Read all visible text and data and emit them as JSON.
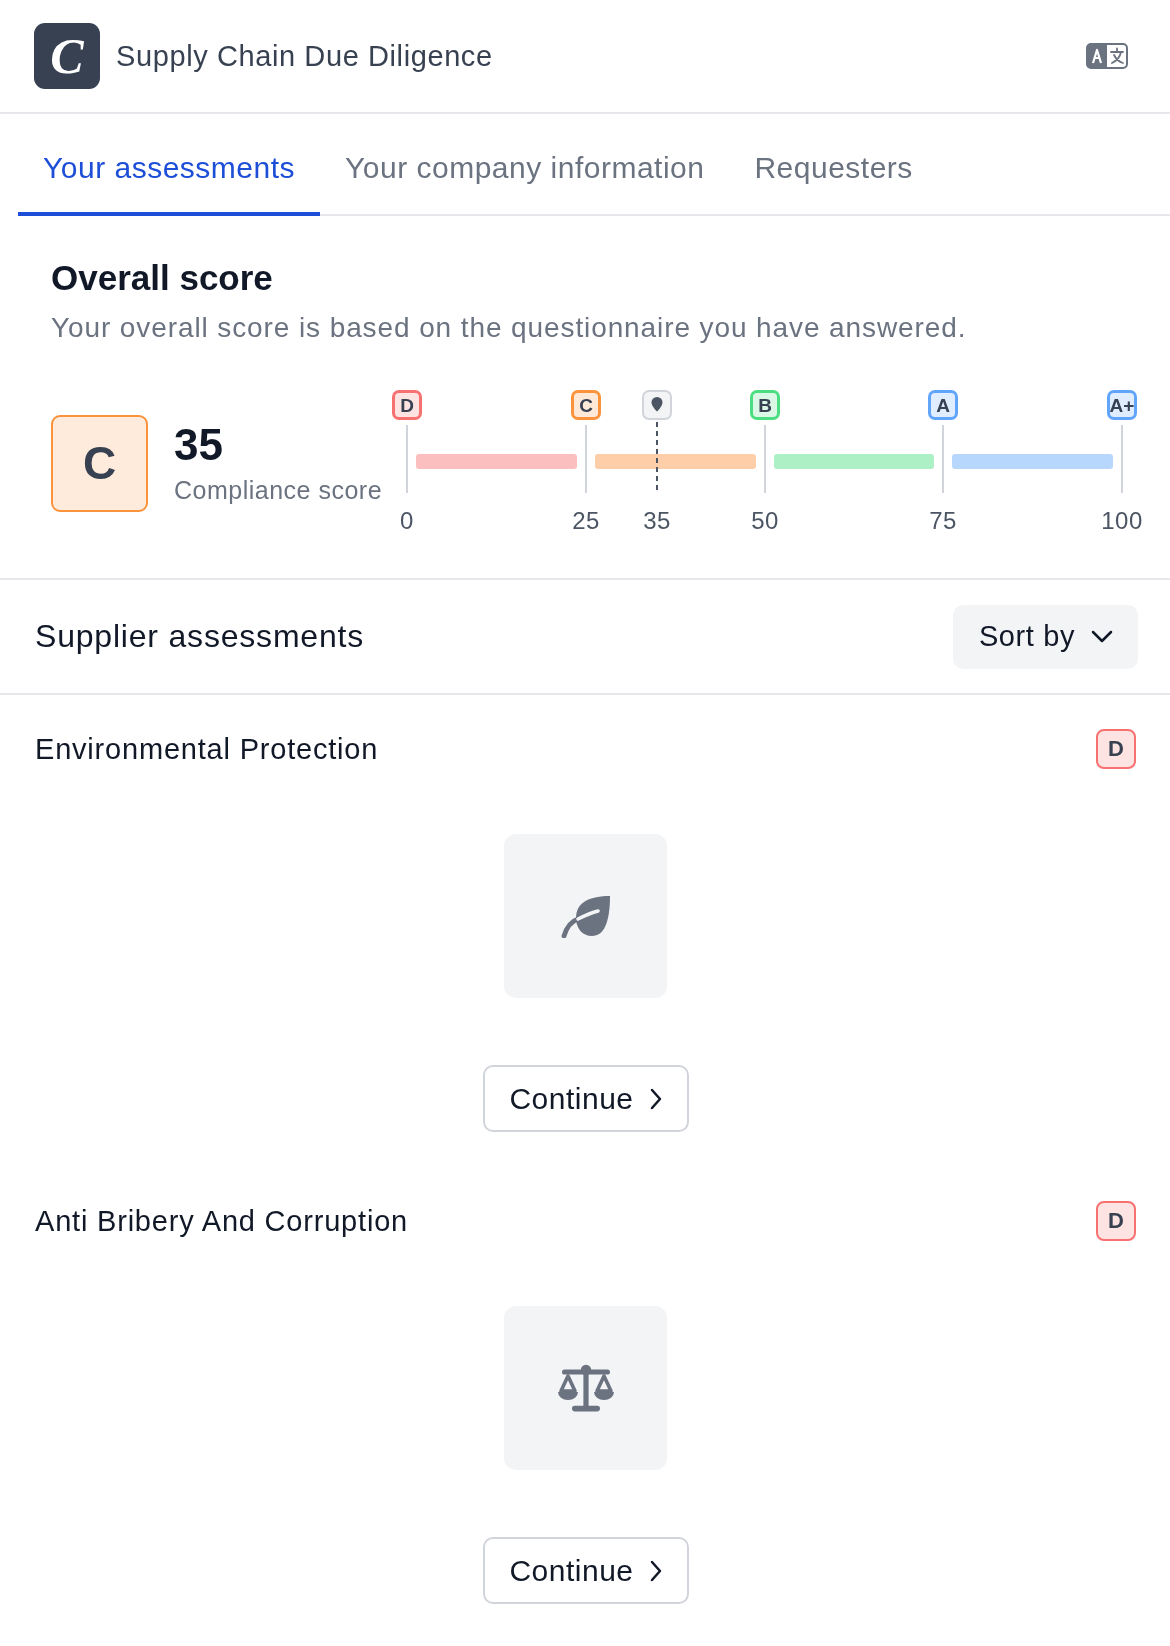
{
  "header": {
    "logo_text": "C",
    "title": "Supply Chain Due Diligence"
  },
  "tabs": [
    {
      "label": "Your assessments",
      "selected": true
    },
    {
      "label": "Your company information",
      "selected": false
    },
    {
      "label": "Requesters",
      "selected": false
    }
  ],
  "overall_score": {
    "title": "Overall score",
    "description": "Your overall score is based on the questionnaire you have answered.",
    "grade": {
      "label": "C",
      "color": "#fb923c"
    },
    "score": "35",
    "score_label": "Compliance score",
    "scale": {
      "level": 0.35,
      "marker_label": "35",
      "ticks": [
        "0",
        "25",
        "50",
        "75",
        "100"
      ],
      "grades": [
        {
          "label": "D",
          "color": "#f87171"
        },
        {
          "label": "C",
          "color": "#fb923c"
        },
        {
          "label": "B",
          "color": "#4ade80"
        },
        {
          "label": "A",
          "color": "#60a5fa"
        },
        {
          "label": "A+",
          "color": "#60a5fa"
        }
      ]
    }
  },
  "supplier_assessments": {
    "title": "Supplier assessments",
    "sort_button": "Sort by",
    "items": [
      {
        "title": "Environmental Protection",
        "kind": "environment",
        "grade": {
          "label": "D",
          "color": "#f87171"
        },
        "button": "Continue"
      },
      {
        "title": "Anti Bribery And Corruption",
        "kind": "bribery",
        "grade": {
          "label": "D",
          "color": "#f87171"
        },
        "button": "Continue"
      }
    ]
  }
}
